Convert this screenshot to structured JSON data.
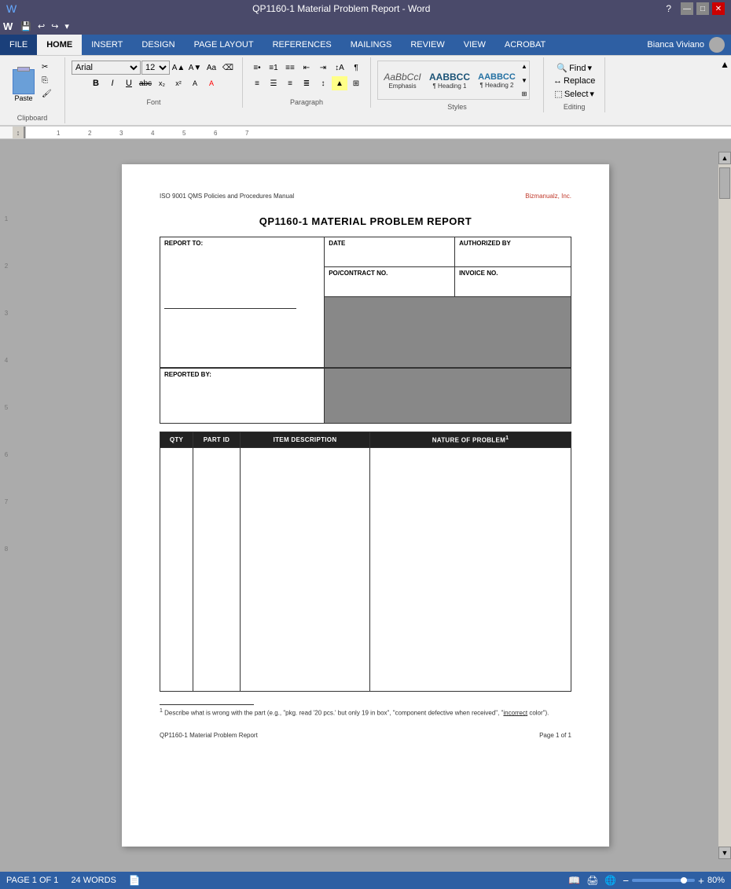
{
  "titlebar": {
    "title": "QP1160-1 Material Problem Report - Word",
    "app": "Word",
    "buttons": [
      "minimize",
      "maximize",
      "close"
    ]
  },
  "quickaccess": {
    "save": "💾",
    "undo": "↩",
    "redo": "↪"
  },
  "ribbon": {
    "tabs": [
      "FILE",
      "HOME",
      "INSERT",
      "DESIGN",
      "PAGE LAYOUT",
      "REFERENCES",
      "MAILINGS",
      "REVIEW",
      "VIEW",
      "ACROBAT"
    ],
    "active_tab": "HOME",
    "groups": {
      "clipboard": {
        "label": "Clipboard",
        "paste": "Paste"
      },
      "font": {
        "label": "Font",
        "family": "Arial",
        "size": "12",
        "bold": "B",
        "italic": "I",
        "underline": "U"
      },
      "paragraph": {
        "label": "Paragraph"
      },
      "styles": {
        "label": "Styles",
        "items": [
          "Emphasis",
          "Heading 1",
          "Heading 2"
        ]
      },
      "editing": {
        "label": "Editing",
        "find": "Find",
        "replace": "Replace",
        "select": "Select"
      }
    }
  },
  "user": {
    "name": "Bianca Viviano"
  },
  "document": {
    "header_left": "ISO 9001 QMS Policies and Procedures Manual",
    "header_right": "Bizmanualz, Inc.",
    "title": "QP1160-1 MATERIAL PROBLEM REPORT",
    "form": {
      "report_to_label": "REPORT TO:",
      "date_label": "DATE",
      "authorized_by_label": "AUTHORIZED BY",
      "po_contract_label": "PO/CONTRACT NO.",
      "invoice_label": "INVOICE NO.",
      "reported_by_label": "REPORTED BY:"
    },
    "table": {
      "headers": [
        "QTY",
        "PART ID",
        "ITEM DESCRIPTION",
        "NATURE OF PROBLEM¹"
      ],
      "nature_superscript": "1"
    },
    "footnote": {
      "number": "1",
      "text": "Describe what is wrong with the part (e.g., \"pkg. read '20 pcs.' but only 19 in box\", \"component defective when received\", \"",
      "underlined": "incorrect",
      "text2": " color\")."
    },
    "footer_left": "QP1160-1 Material Problem Report",
    "footer_right": "Page 1 of 1"
  },
  "statusbar": {
    "page": "PAGE 1 OF 1",
    "words": "24 WORDS",
    "zoom": "80%"
  }
}
